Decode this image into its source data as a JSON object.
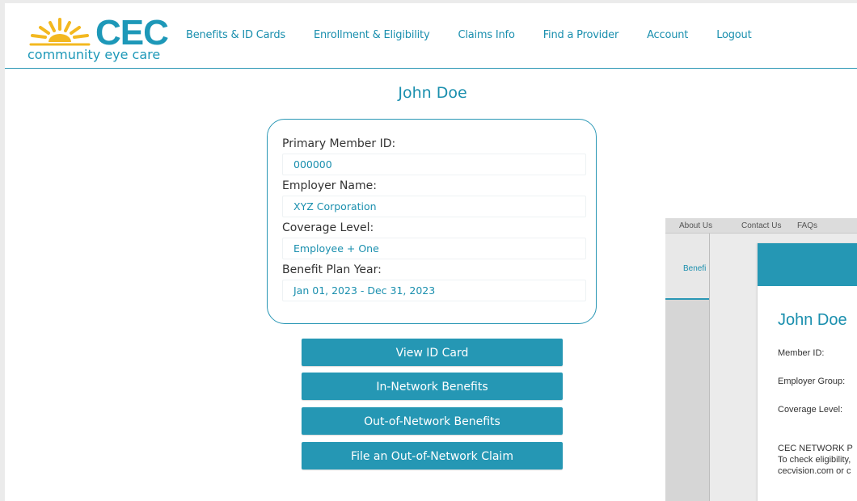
{
  "brand": {
    "name": "CEC",
    "tagline": "community eye care",
    "primary_color": "#1d98b8",
    "sun_color": "#f3b820",
    "logo_icon": "sun-icon"
  },
  "nav": {
    "items": [
      "Benefits & ID Cards",
      "Enrollment & Eligibility",
      "Claims Info",
      "Find a Provider",
      "Account",
      "Logout"
    ]
  },
  "member": {
    "name": "John Doe",
    "fields": [
      {
        "label": "Primary Member ID:",
        "value": "000000"
      },
      {
        "label": "Employer Name:",
        "value": "XYZ Corporation"
      },
      {
        "label": "Coverage Level:",
        "value": "Employee + One"
      },
      {
        "label": "Benefit Plan Year:",
        "value": "Jan 01, 2023 - Dec 31, 2023"
      }
    ]
  },
  "actions": [
    "View ID Card",
    "In-Network Benefits",
    "Out-of-Network Benefits",
    "File an Out-of-Network Claim"
  ],
  "button_color": "#2597b4",
  "overlay": {
    "topbar": [
      "About Us",
      "Contact Us",
      "FAQs"
    ],
    "left_nav": "Benefi",
    "id_card": {
      "name": "John Doe",
      "rows": [
        "Member ID:",
        "Employer Group:",
        "Coverage Level:",
        "CEC NETWORK P",
        "To check eligibility,",
        "cecvision.com or c"
      ]
    }
  }
}
